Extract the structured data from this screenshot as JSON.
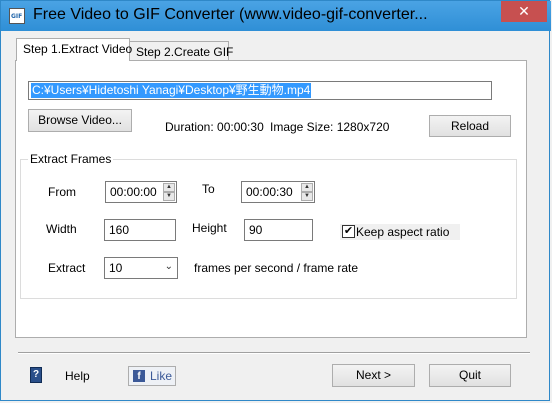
{
  "window": {
    "title": "Free Video to GIF Converter (www.video-gif-converter...",
    "close": "✕"
  },
  "tabs": [
    {
      "label": "Step 1.Extract Video",
      "active": true
    },
    {
      "label": "Step 2.Create GIF",
      "active": false
    }
  ],
  "video": {
    "path": "C:¥Users¥Hidetoshi Yanagi¥Desktop¥野生動物.mp4",
    "browse_label": "Browse Video...",
    "duration": "Duration: 00:00:30",
    "image_size": "Image Size: 1280x720",
    "reload_label": "Reload"
  },
  "extract_frames": {
    "group_title": "Extract Frames",
    "from_label": "From",
    "from_value": "00:00:00",
    "to_label": "To",
    "to_value": "00:00:30",
    "width_label": "Width",
    "width_value": "160",
    "height_label": "Height",
    "height_value": "90",
    "keep_aspect_label": "Keep aspect ratio",
    "keep_aspect_checked": true,
    "check_mark": "✔",
    "extract_label": "Extract",
    "extract_value": "10",
    "fps_label": "frames per second / frame rate"
  },
  "footer": {
    "help_icon": "?",
    "help_label": "Help",
    "fb_icon": "f",
    "like_label": "Like",
    "next_label": "Next >",
    "quit_label": "Quit"
  },
  "colors": {
    "titlebar": "#3c9ae0",
    "close": "#c75050",
    "selection": "#3399ff",
    "facebook": "#3b5998"
  }
}
